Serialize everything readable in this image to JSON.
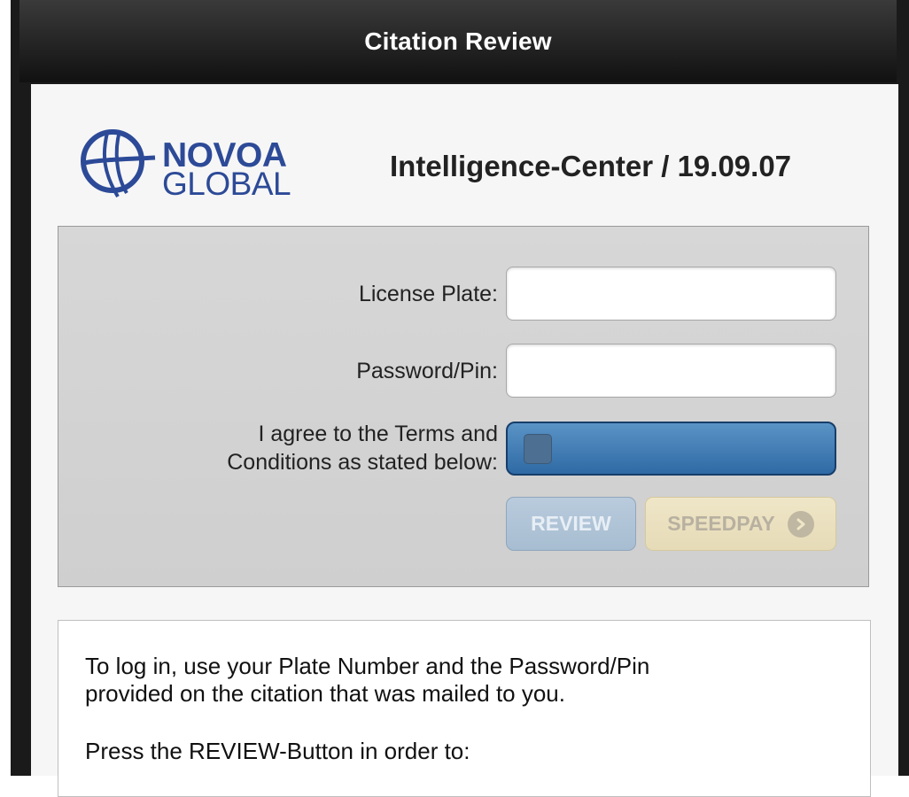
{
  "header": {
    "title": "Citation Review"
  },
  "logo": {
    "line1": "NOVOA",
    "line2": "GLOBAL",
    "brand_color": "#2c4a97"
  },
  "page": {
    "heading": "Intelligence-Center / 19.09.07"
  },
  "form": {
    "license_plate_label": "License Plate:",
    "license_plate_value": "",
    "password_label": "Password/Pin:",
    "password_value": "",
    "terms_label_line1": "I agree to the Terms and",
    "terms_label_line2": "Conditions as stated below:",
    "terms_toggle_state": "off",
    "review_button": "REVIEW",
    "speedpay_button": "SPEEDPAY",
    "toggle_color": "#2f6aa5"
  },
  "info": {
    "paragraph1": "To log in, use your Plate Number and the Password/Pin provided on the citation that was mailed to you.",
    "paragraph2": "Press the REVIEW-Button in order to:"
  }
}
